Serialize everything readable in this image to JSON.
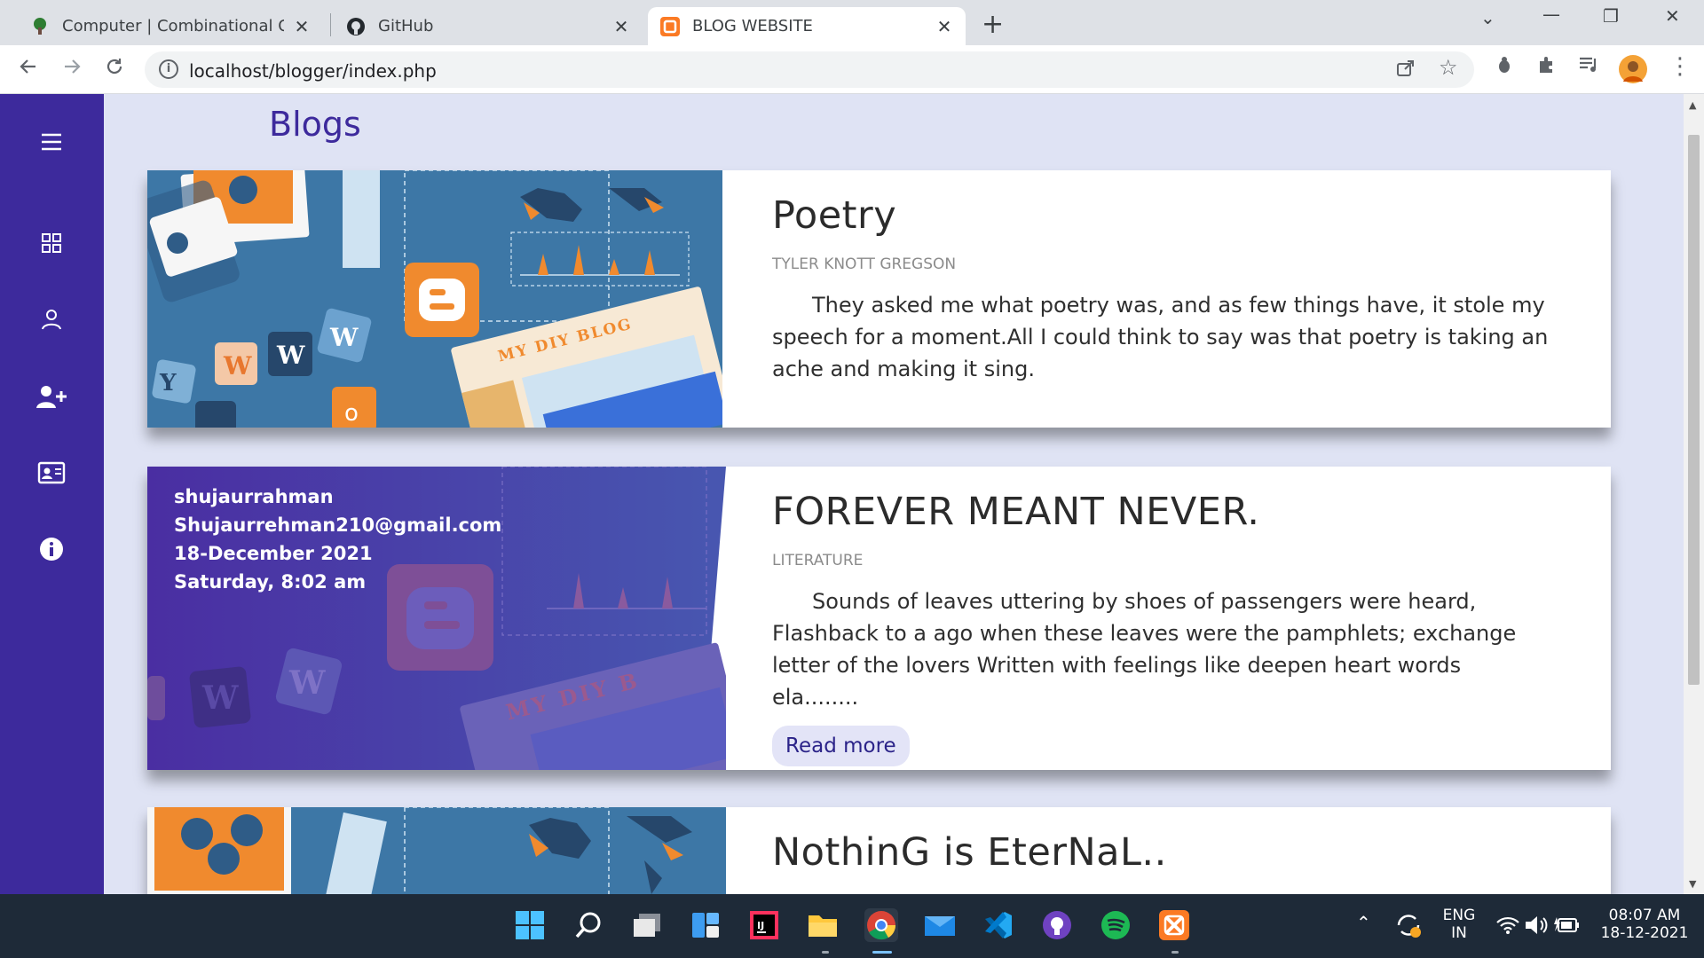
{
  "browser": {
    "tabs": [
      {
        "title": "Computer | Combinational Circuit",
        "favicon": "tree-favicon-icon"
      },
      {
        "title": "GitHub",
        "favicon": "github-icon"
      },
      {
        "title": "BLOG WEBSITE",
        "favicon": "xampp-favicon-icon"
      }
    ],
    "url": "localhost/blogger/index.php"
  },
  "page": {
    "title": "Blogs",
    "sidebar": [
      "menu-icon",
      "dashboard-icon",
      "user-icon",
      "add-user-icon",
      "contact-card-icon",
      "info-icon"
    ],
    "posts": [
      {
        "title": "Poetry",
        "category": "TYLER KNOTT GREGSON",
        "text": "They asked me what poetry was, and as few things have, it stole my speech for a moment.All I could think to say was that poetry is taking an ache and making it sing.",
        "image_text": "MY DIY BLOG"
      },
      {
        "title": "FOREVER MEANT NEVER.",
        "category": "LITERATURE",
        "text": "Sounds of leaves uttering by shoes of passengers were heard, Flashback to a ago when these leaves were the pamphlets; exchange letter of the lovers Written with feelings like deepen heart words ela........",
        "read_more": "Read more",
        "author": "shujaurrahman",
        "email": "Shujaurrehman210@gmail.com",
        "date": "18-December 2021",
        "time": "Saturday, 8:02 am",
        "image_text": "MY DIY B"
      },
      {
        "title": "NothinG is EterNaL.."
      }
    ]
  },
  "taskbar": {
    "lang": "ENG",
    "region": "IN",
    "time": "08:07 AM",
    "date": "18-12-2021"
  },
  "colors": {
    "sidebar": "#3d2a9c",
    "background": "#dfe3f4",
    "accent": "#3d2a9c",
    "image_blue": "#3d77a6",
    "orange": "#f08a2e"
  }
}
